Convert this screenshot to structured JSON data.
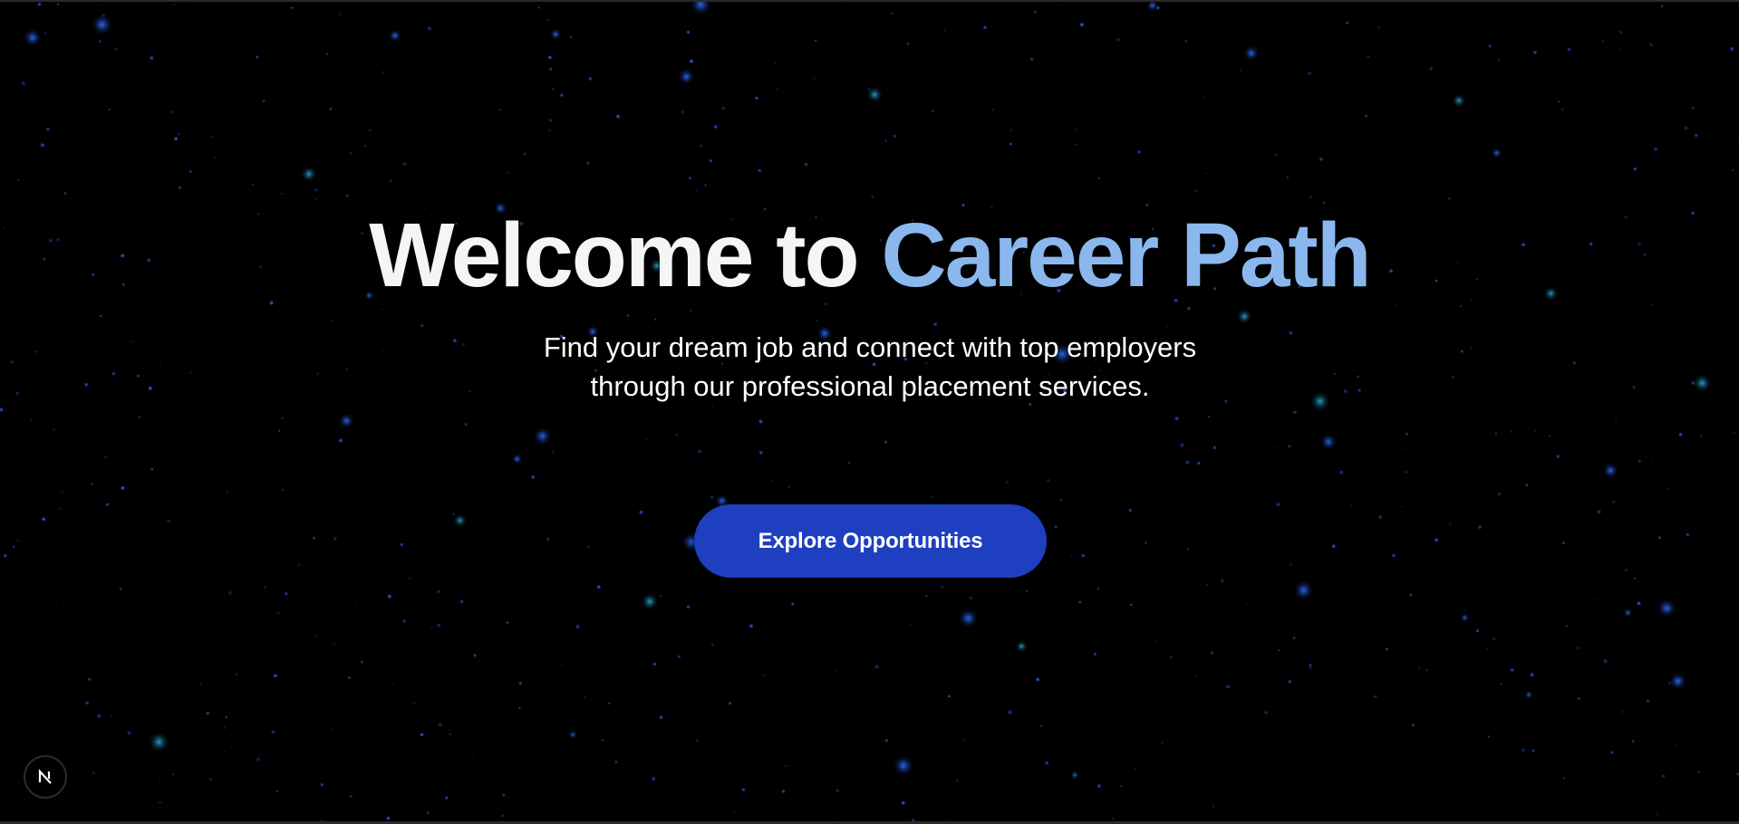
{
  "hero": {
    "title_prefix": "Welcome to ",
    "title_accent": "Career Path",
    "subtitle": "Find your dream job and connect with top employers through our professional placement services.",
    "cta_label": "Explore Opportunities"
  },
  "badge": {
    "icon": "nextjs-logo-icon"
  },
  "colors": {
    "background": "#000000",
    "title_text": "#f5f5f5",
    "accent": "#8ab8ee",
    "button": "#1d3fc0",
    "stars": "#2a6cf0"
  }
}
